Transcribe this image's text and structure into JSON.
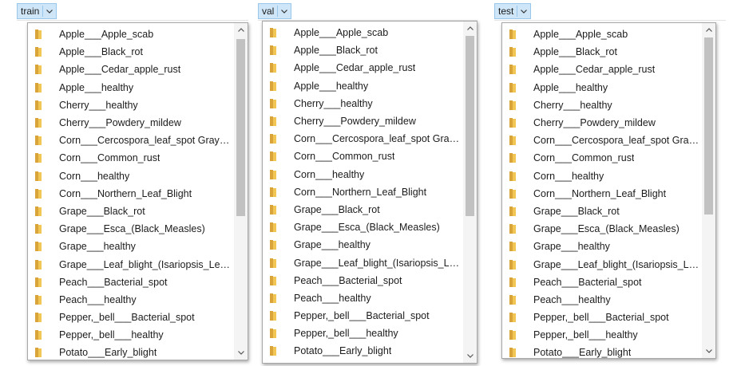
{
  "panels": [
    {
      "tab_label": "train",
      "items": [
        "Apple___Apple_scab",
        "Apple___Black_rot",
        "Apple___Cedar_apple_rust",
        "Apple___healthy",
        "Cherry___healthy",
        "Cherry___Powdery_mildew",
        "Corn___Cercospora_leaf_spot Gray_lea...",
        "Corn___Common_rust",
        "Corn___healthy",
        "Corn___Northern_Leaf_Blight",
        "Grape___Black_rot",
        "Grape___Esca_(Black_Measles)",
        "Grape___healthy",
        "Grape___Leaf_blight_(Isariopsis_Leaf_S...",
        "Peach___Bacterial_spot",
        "Peach___healthy",
        "Pepper,_bell___Bacterial_spot",
        "Pepper,_bell___healthy",
        "Potato___Early_blight"
      ]
    },
    {
      "tab_label": "val",
      "items": [
        "Apple___Apple_scab",
        "Apple___Black_rot",
        "Apple___Cedar_apple_rust",
        "Apple___healthy",
        "Cherry___healthy",
        "Cherry___Powdery_mildew",
        "Corn___Cercospora_leaf_spot Gray_lea...",
        "Corn___Common_rust",
        "Corn___healthy",
        "Corn___Northern_Leaf_Blight",
        "Grape___Black_rot",
        "Grape___Esca_(Black_Measles)",
        "Grape___healthy",
        "Grape___Leaf_blight_(Isariopsis_Leaf_S...",
        "Peach___Bacterial_spot",
        "Peach___healthy",
        "Pepper,_bell___Bacterial_spot",
        "Pepper,_bell___healthy",
        "Potato___Early_blight"
      ]
    },
    {
      "tab_label": "test",
      "items": [
        "Apple___Apple_scab",
        "Apple___Black_rot",
        "Apple___Cedar_apple_rust",
        "Apple___healthy",
        "Cherry___healthy",
        "Cherry___Powdery_mildew",
        "Corn___Cercospora_leaf_spot Gray_lea...",
        "Corn___Common_rust",
        "Corn___healthy",
        "Corn___Northern_Leaf_Blight",
        "Grape___Black_rot",
        "Grape___Esca_(Black_Measles)",
        "Grape___healthy",
        "Grape___Leaf_blight_(Isariopsis_Leaf_S...",
        "Peach___Bacterial_spot",
        "Peach___healthy",
        "Pepper,_bell___Bacterial_spot",
        "Pepper,_bell___healthy",
        "Potato___Early_blight"
      ]
    }
  ],
  "icons": {
    "item": "folder-icon",
    "tab_dropdown": "chevron-down-icon",
    "scroll_up": "scroll-up-arrow-icon",
    "scroll_down": "scroll-down-arrow-icon"
  },
  "colors": {
    "tab_background": "#cfe6f8",
    "tab_border": "#99c7ec",
    "folder": "#f2c655",
    "folder_dark": "#d9a53a",
    "scroll_thumb": "#c1c1c1"
  }
}
